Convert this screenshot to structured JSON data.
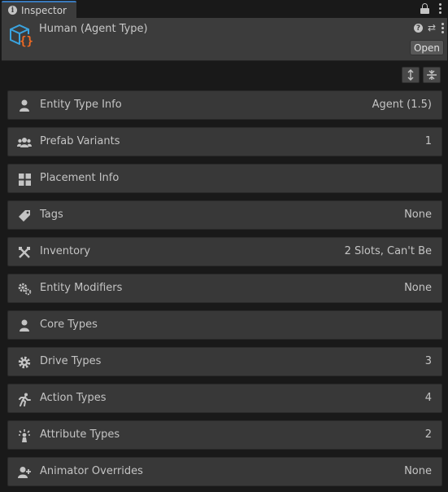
{
  "tab": {
    "label": "Inspector"
  },
  "header": {
    "title": "Human (Agent Type)",
    "open_label": "Open"
  },
  "colors": {
    "accent": "#3a79bb",
    "asset_icon_blue": "#3aa4e0",
    "asset_icon_orange": "#f06a22"
  },
  "rows": [
    {
      "icon": "person-icon",
      "label": "Entity Type Info",
      "value": "Agent (1.5)"
    },
    {
      "icon": "group-icon",
      "label": "Prefab Variants",
      "value": "1"
    },
    {
      "icon": "grid-icon",
      "label": "Placement Info",
      "value": ""
    },
    {
      "icon": "tag-icon",
      "label": "Tags",
      "value": "None"
    },
    {
      "icon": "crossed-tools-icon",
      "label": "Inventory",
      "value": "2 Slots, Can't Be"
    },
    {
      "icon": "gears-icon",
      "label": "Entity Modifiers",
      "value": "None"
    },
    {
      "icon": "person-icon",
      "label": "Core Types",
      "value": ""
    },
    {
      "icon": "gear-icon",
      "label": "Drive Types",
      "value": "3"
    },
    {
      "icon": "running-icon",
      "label": "Action Types",
      "value": "4"
    },
    {
      "icon": "sparkle-person-icon",
      "label": "Attribute Types",
      "value": "2"
    },
    {
      "icon": "person-add-icon",
      "label": "Animator Overrides",
      "value": "None"
    }
  ]
}
